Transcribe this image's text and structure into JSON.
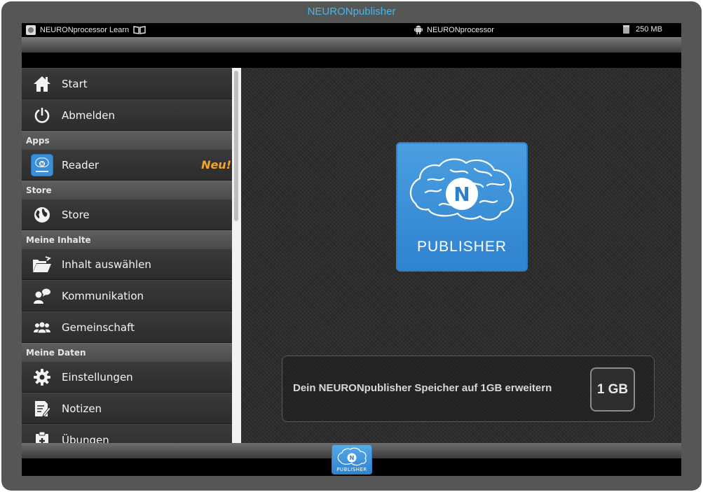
{
  "window": {
    "title": "NEURONpublisher"
  },
  "statusbar": {
    "app_name": "NEURONprocessor Learn",
    "device_name": "NEURONprocessor",
    "storage": "250 MB"
  },
  "sidebar": {
    "items": [
      {
        "label": "Start",
        "icon": "home-icon"
      },
      {
        "label": "Abmelden",
        "icon": "power-icon"
      }
    ],
    "sections": [
      {
        "header": "Apps",
        "items": [
          {
            "label": "Reader",
            "icon": "publisher-app-icon",
            "badge": "Neu!"
          }
        ]
      },
      {
        "header": "Store",
        "items": [
          {
            "label": "Store",
            "icon": "globe-icon"
          }
        ]
      },
      {
        "header": "Meine Inhalte",
        "items": [
          {
            "label": "Inhalt auswählen",
            "icon": "folder-open-icon"
          },
          {
            "label": "Kommunikation",
            "icon": "chat-user-icon"
          },
          {
            "label": "Gemeinschaft",
            "icon": "group-icon"
          }
        ]
      },
      {
        "header": "Meine Daten",
        "items": [
          {
            "label": "Einstellungen",
            "icon": "gear-icon"
          },
          {
            "label": "Notizen",
            "icon": "notes-icon"
          },
          {
            "label": "Übungen",
            "icon": "clipboard-icon"
          }
        ]
      }
    ]
  },
  "main": {
    "logo_text": "PUBLISHER",
    "logo_letter": "N",
    "upgrade_text": "Dein NEURONpublisher Speicher auf 1GB erweitern",
    "upgrade_button": "1 GB"
  },
  "dock": {
    "icon_text": "PUBLISHER",
    "icon_letter": "N"
  },
  "colors": {
    "accent_blue": "#3a8fd8",
    "title_blue": "#4ab6e8",
    "badge_orange": "#f2a531"
  }
}
